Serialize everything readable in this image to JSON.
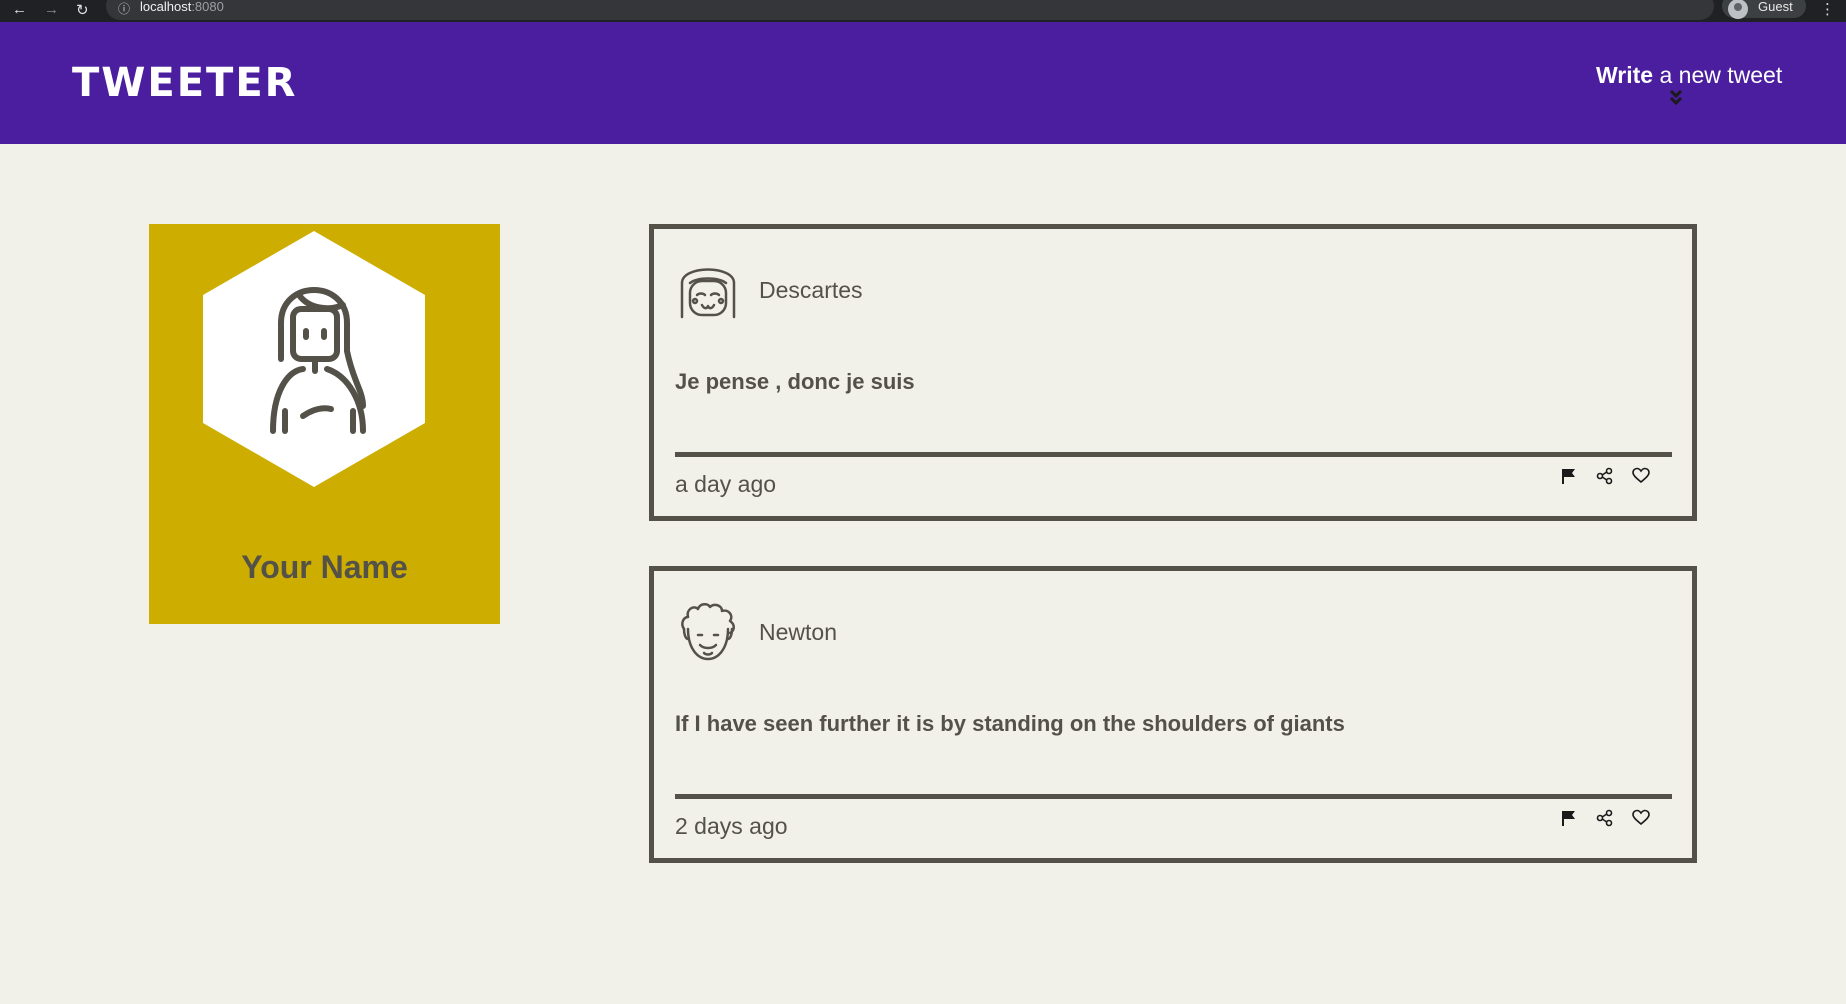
{
  "browser": {
    "url_host": "localhost",
    "url_port": ":8080",
    "profile_label": "Guest"
  },
  "header": {
    "logo": "TWEETER",
    "compose_bold": "Write",
    "compose_rest": " a new tweet"
  },
  "profile": {
    "name": "Your Name"
  },
  "tweets": [
    {
      "author": "Descartes",
      "content": "Je pense , donc je suis",
      "time": "a day ago"
    },
    {
      "author": "Newton",
      "content": "If I have seen further it is by standing on the shoulders of giants",
      "time": "2 days ago"
    }
  ],
  "colors": {
    "header_bg": "#4a1e9e",
    "page_bg": "#f1f0e9",
    "profile_bg": "#cdad00",
    "text_dark": "#545149"
  }
}
